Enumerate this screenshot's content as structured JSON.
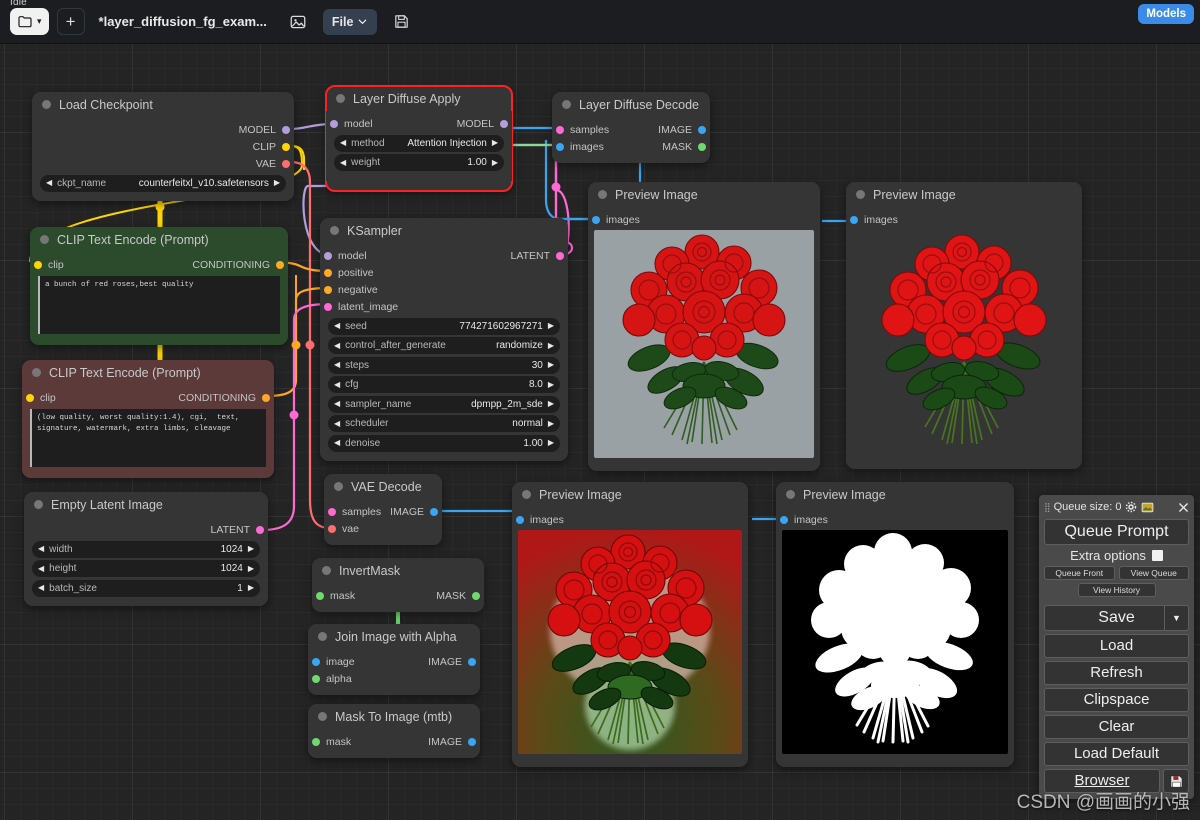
{
  "app": {
    "status": "Idle",
    "workflow_title": "*layer_diffusion_fg_exam...",
    "models_badge": "Models",
    "watermark": "CSDN @画画的小强"
  },
  "toolbar": {
    "folder_icon": "folder-icon",
    "folder_caret": "▾",
    "new_label": "+",
    "image_icon": "image-icon",
    "file_label": "File",
    "file_caret": "⌄",
    "save_icon": "floppy-disk-icon"
  },
  "nodes": {
    "load_checkpoint": {
      "title": "Load Checkpoint",
      "outputs": [
        "MODEL",
        "CLIP",
        "VAE"
      ],
      "widgets": [
        {
          "name": "ckpt_name",
          "value": "counterfeitxl_v10.safetensors"
        }
      ]
    },
    "layer_diffuse_apply": {
      "title": "Layer Diffuse Apply",
      "inputs": [
        "model"
      ],
      "outputs": [
        "MODEL"
      ],
      "widgets": [
        {
          "name": "method",
          "value": "Attention Injection"
        },
        {
          "name": "weight",
          "value": "1.00"
        }
      ]
    },
    "layer_diffuse_decode": {
      "title": "Layer Diffuse Decode",
      "inputs": [
        "samples",
        "images"
      ],
      "outputs": [
        "IMAGE",
        "MASK"
      ]
    },
    "clip_positive": {
      "title": "CLIP Text Encode (Prompt)",
      "inputs": [
        "clip"
      ],
      "outputs": [
        "CONDITIONING"
      ],
      "text": "a bunch of red roses,best quality"
    },
    "clip_negative": {
      "title": "CLIP Text Encode (Prompt)",
      "inputs": [
        "clip"
      ],
      "outputs": [
        "CONDITIONING"
      ],
      "text": "(low quality, worst quality:1.4), cgi,  text,\nsignature, watermark, extra limbs, cleavage"
    },
    "ksampler": {
      "title": "KSampler",
      "inputs": [
        "model",
        "positive",
        "negative",
        "latent_image"
      ],
      "outputs": [
        "LATENT"
      ],
      "widgets": [
        {
          "name": "seed",
          "value": "774271602967271"
        },
        {
          "name": "control_after_generate",
          "value": "randomize"
        },
        {
          "name": "steps",
          "value": "30"
        },
        {
          "name": "cfg",
          "value": "8.0"
        },
        {
          "name": "sampler_name",
          "value": "dpmpp_2m_sde"
        },
        {
          "name": "scheduler",
          "value": "normal"
        },
        {
          "name": "denoise",
          "value": "1.00"
        }
      ]
    },
    "empty_latent": {
      "title": "Empty Latent Image",
      "outputs": [
        "LATENT"
      ],
      "widgets": [
        {
          "name": "width",
          "value": "1024"
        },
        {
          "name": "height",
          "value": "1024"
        },
        {
          "name": "batch_size",
          "value": "1"
        }
      ]
    },
    "vae_decode": {
      "title": "VAE Decode",
      "inputs": [
        "samples",
        "vae"
      ],
      "outputs": [
        "IMAGE"
      ]
    },
    "invert_mask": {
      "title": "InvertMask",
      "inputs": [
        "mask"
      ],
      "outputs": [
        "MASK"
      ]
    },
    "join_image_alpha": {
      "title": "Join Image with Alpha",
      "inputs": [
        "image",
        "alpha"
      ],
      "outputs": [
        "IMAGE"
      ]
    },
    "mask_to_image": {
      "title": "Mask To Image (mtb)",
      "inputs": [
        "mask"
      ],
      "outputs": [
        "IMAGE"
      ]
    },
    "preview_1": {
      "title": "Preview Image",
      "inputs": [
        "images"
      ]
    },
    "preview_2": {
      "title": "Preview Image",
      "inputs": [
        "images"
      ]
    },
    "preview_3": {
      "title": "Preview Image",
      "inputs": [
        "images"
      ]
    },
    "preview_4": {
      "title": "Preview Image",
      "inputs": [
        "images"
      ]
    }
  },
  "queue_panel": {
    "header": "Queue size: 0",
    "gear_icon": "gear-icon",
    "gallery_icon": "gallery-icon",
    "close_icon": "close-icon",
    "queue_prompt": "Queue Prompt",
    "extra_options": "Extra options",
    "queue_front": "Queue Front",
    "view_queue": "View Queue",
    "view_history": "View History",
    "save": "Save",
    "save_caret": "▼",
    "load": "Load",
    "refresh": "Refresh",
    "clipspace": "Clipspace",
    "clear": "Clear",
    "load_default": "Load Default",
    "browser": "Browser",
    "browser_save_icon": "floppy-disk-icon"
  },
  "colors": {
    "model_link": "#b39ddb",
    "clip_link": "#ffd500",
    "vae_link": "#ff6e6e",
    "cond_link": "#ffa726",
    "latent_link": "#ff69d4",
    "image_link": "#3aa5f0",
    "mask_link": "#6fd96f",
    "accent_blue": "#3b8ce8",
    "selection": "#ff2020",
    "node_bg": "#353535",
    "green_node": "#2c4a2c",
    "maroon_node": "#5c3a3a"
  }
}
